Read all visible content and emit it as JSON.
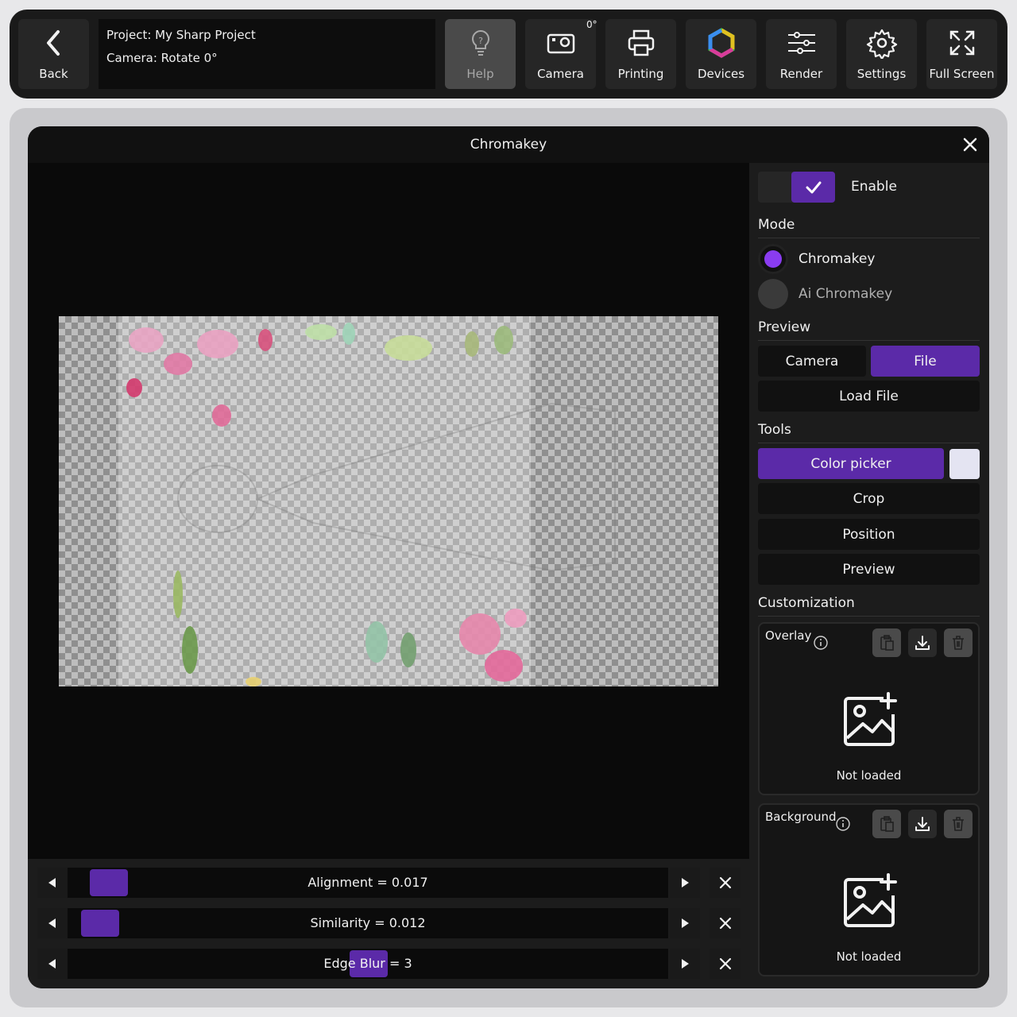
{
  "topbar": {
    "back_label": "Back",
    "project_line": "Project: My Sharp Project",
    "camera_line": "Camera: Rotate 0°",
    "rotation_badge": "0°",
    "buttons": {
      "help": "Help",
      "camera": "Camera",
      "printing": "Printing",
      "devices": "Devices",
      "render": "Render",
      "settings": "Settings",
      "fullscreen": "Full Screen"
    }
  },
  "dialog": {
    "title": "Chromakey"
  },
  "panel": {
    "enable_label": "Enable",
    "enabled": true,
    "mode_heading": "Mode",
    "modes": [
      "Chromakey",
      "Ai Chromakey"
    ],
    "selected_mode": "Chromakey",
    "preview_heading": "Preview",
    "preview_camera": "Camera",
    "preview_file": "File",
    "selected_preview": "File",
    "load_file": "Load File",
    "tools_heading": "Tools",
    "color_picker": "Color picker",
    "picked_color": "#e4e4f2",
    "crop": "Crop",
    "position": "Position",
    "preview_tool": "Preview",
    "customization_heading": "Customization",
    "overlay": {
      "title": "Overlay",
      "status": "Not loaded"
    },
    "background": {
      "title": "Background",
      "status": "Not loaded"
    }
  },
  "sliders": {
    "alignment": "Alignment = 0.017",
    "similarity": "Similarity = 0.012",
    "edge_blur": "Edge Blur = 3"
  },
  "colors": {
    "accent": "#5b2aa8",
    "radio_on": "#8a3cf0"
  }
}
